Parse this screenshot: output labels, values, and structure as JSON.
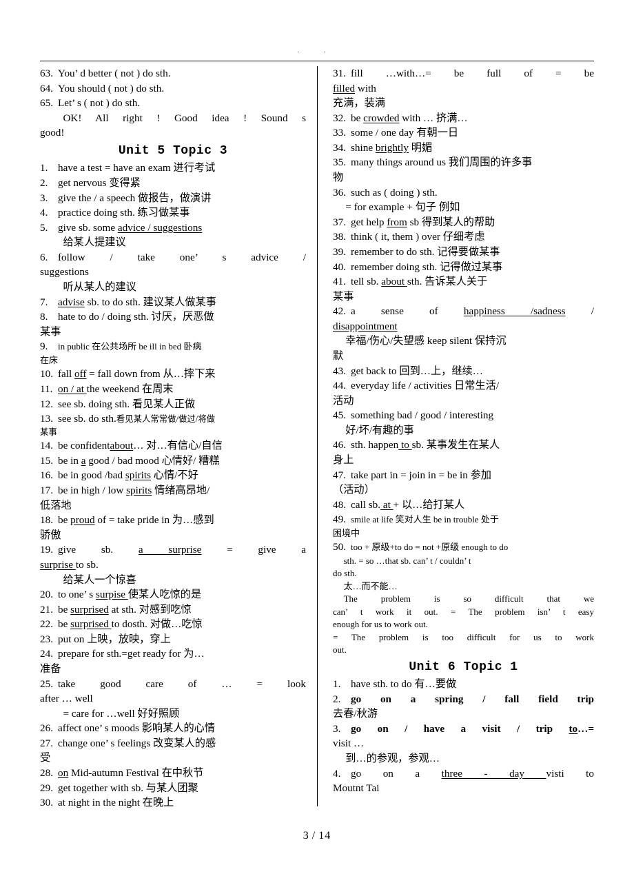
{
  "document": {
    "header_marks": "· ·",
    "footer": {
      "page": "3",
      "separator": "/",
      "total": "14"
    }
  },
  "left_column": {
    "entries": [
      {
        "num": "63.",
        "text": "You’ d better ( not ) do sth."
      },
      {
        "num": "64.",
        "text": "You should ( not ) do sth."
      },
      {
        "num": "65.",
        "text": "Let’ s ( not ) do sth."
      },
      {
        "num": "",
        "text": "OK! All right ! Good idea ! Sound s"
      },
      {
        "num": "",
        "text": "good!"
      }
    ],
    "unit_heading": "Unit 5 Topic 3",
    "items": [
      {
        "num": "1.",
        "line1": "have a test = have an exam 进行考试"
      },
      {
        "num": "2.",
        "line1": "get nervous  变得紧"
      },
      {
        "num": "3.",
        "line1": "give the / a speech 做报告，做演讲"
      },
      {
        "num": "4.",
        "line1": "practice doing sth. 练习做某事"
      },
      {
        "num": "5.",
        "line1_pre": "give sb. some ",
        "line1_u": "advice / suggestions",
        "line2": "给某人提建议"
      },
      {
        "num": "6.",
        "line1": "follow / take one’ s advice /",
        "line2": "suggestions",
        "line3": "听从某人的建议"
      },
      {
        "num": "7.",
        "line1_u": "advise",
        "line1_post": " sb. to do sth. 建议某人做某事"
      },
      {
        "num": "8.",
        "line1": "hate to do / doing sth. 讨厌，厌恶做",
        "line2": "某事"
      },
      {
        "num": "9.",
        "line1": "in public 在公共场所 be ill in bed  卧病",
        "line2": "在床",
        "small": true
      },
      {
        "num": "10.",
        "line1_pre": "fall ",
        "line1_u": "off",
        "line1_post": " = fall down from 从…摔下来"
      },
      {
        "num": "11.",
        "line1_u": "on / at ",
        "line1_post": "the weekend  在周末"
      },
      {
        "num": "12.",
        "line1": "see sb. doing sth. 看见某人正做"
      },
      {
        "num": "13.",
        "line1": "see sb. do sth.",
        "line1_small": "看见某人常常做/做过/将做",
        "line2_small": "某事"
      },
      {
        "num": "14.",
        "line1_pre": "be confident",
        "line1_u": "about",
        "line1_post": "… 对…有信心/自信"
      },
      {
        "num": "15.",
        "line1_pre": "be in ",
        "line1_u": "a",
        "line1_post": " good / bad mood 心情好/ 糟糕"
      },
      {
        "num": "16.",
        "line1_pre": "be in good /bad ",
        "line1_u": "spirits",
        "line1_post": "  心情/不好"
      },
      {
        "num": "17.",
        "line1_pre": "be in high / low ",
        "line1_u": "spirits",
        "line1_post": " 情绪高昂地/",
        "line2": "低落地"
      },
      {
        "num": "18.",
        "line1_pre": "be ",
        "line1_u": "proud",
        "line1_post": " of = take pride in 为…感到",
        "line2": "骄傲"
      },
      {
        "num": "19.",
        "line1_pre": "give sb. ",
        "line1_u": "a  surprise",
        "line1_post": " = give a",
        "line2_u": "surprise ",
        "line2_post": "to sb.",
        "line3": "给某人一个惊喜"
      },
      {
        "num": "20.",
        "line1_pre": "to one’ s ",
        "line1_u": "surpise ",
        "line1_post": "使某人吃惊的是"
      },
      {
        "num": "21.",
        "line1_pre": "be ",
        "line1_u": "surprised",
        "line1_post": " at sth. 对感到吃惊"
      },
      {
        "num": "22.",
        "line1_pre": "be ",
        "line1_u": "surprised ",
        "line1_post": "to dosth. 对做…吃惊"
      },
      {
        "num": "23.",
        "line1": "put on 上映，放映，穿上"
      },
      {
        "num": "24.",
        "line1": "prepare for sth.=get ready for  为…",
        "line2": "准备"
      },
      {
        "num": "25.",
        "line1": "take good care of …  = look",
        "line2": "after … well",
        "line3": "= care for …well    好好照顾"
      },
      {
        "num": "26.",
        "line1": "affect one’ s moods 影响某人的心情"
      },
      {
        "num": "27.",
        "line1": "change one’ s feelings  改变某人的感",
        "line2": "受"
      },
      {
        "num": "28.",
        "line1_u": "on",
        "line1_post": " Mid-autumn Festival  在中秋节"
      },
      {
        "num": "29.",
        "line1": "get together with sb.    与某人团聚"
      },
      {
        "num": "30.",
        "line1": "at night   in the night   在晚上"
      }
    ]
  },
  "right_column": {
    "items": [
      {
        "num": "31.",
        "line1": "fill  …with…=  be  full  of  =  be",
        "line2_u": "filled",
        "line2_post": " with",
        "line3": "充满，装满"
      },
      {
        "num": "32.",
        "line1_pre": "be ",
        "line1_u": "crowded",
        "line1_post": " with …   挤满…"
      },
      {
        "num": "33.",
        "line1": "some / one day   有朝一日"
      },
      {
        "num": "34.",
        "line1_pre": "shine ",
        "line1_u": "brightly",
        "line1_post": "    明媚"
      },
      {
        "num": "35.",
        "line1": "many things around us 我们周围的许多事",
        "line2": "物"
      },
      {
        "num": "36.",
        "line1": "such as ( doing ) sth.",
        "line2": "= for example +     句子   例如"
      },
      {
        "num": "37.",
        "line1_pre": "get help ",
        "line1_u": "from",
        "line1_post": " sb  得到某人的帮助"
      },
      {
        "num": "38.",
        "line1": "think ( it, them ) over     仔细考虑"
      },
      {
        "num": "39.",
        "line1": "remember to do sth. 记得要做某事"
      },
      {
        "num": "40.",
        "line1": "remember doing sth. 记得做过某事"
      },
      {
        "num": "41.",
        "line1_pre": "tell sb. ",
        "line1_u": "about ",
        "line1_post": "sth.    告诉某人关于",
        "line2": "某事"
      },
      {
        "num": "42.",
        "line1_pre": "a  sense  of  ",
        "line1_u": "happiness  /sadness",
        "line1_post": "  /",
        "line2_u": "disappointment",
        "line3": "幸福/伤心/失望感  keep silent 保持沉",
        "line4": "默"
      },
      {
        "num": "43.",
        "line1": "get back to      回到…上，继续…"
      },
      {
        "num": "44.",
        "line1": "everyday life / activities 日常生活/",
        "line2": "活动"
      },
      {
        "num": "45.",
        "line1": "something bad / good / interesting",
        "line2": "好/坏/有趣的事"
      },
      {
        "num": "46.",
        "line1_pre": "sth. happen",
        "line1_u": " to ",
        "line1_post": "sb.    某事发生在某人",
        "line2": "身上"
      },
      {
        "num": "47.",
        "line1": "take part in = join in = be in  参加",
        "line2": "（活动）"
      },
      {
        "num": "48.",
        "line1_pre": "call sb.",
        "line1_u": " at ",
        "line1_post": "+    以…给打某人"
      },
      {
        "num": "49.",
        "line1": "smile at life 笑对人生 be in trouble 处于",
        "line2": "困境中"
      },
      {
        "num": "50.",
        "line1": "too + 原级+to do   = not +原级 enough to do",
        "line2": "sth. = so …that sb. can’ t / couldn’ t",
        "line3": "do sth.",
        "line4": "太…而不能…"
      }
    ],
    "paragraph": {
      "l1": "The  problem  is  so  difficult  that  we",
      "l2": "can’ t work it out. = The problem isn’ t easy",
      "l3": "enough for us to work out.",
      "l4": "= The problem is too difficult for us to work",
      "l5": "out."
    },
    "unit_heading": "Unit 6 Topic 1",
    "unit6_items": [
      {
        "num": "1.",
        "line1": "have sth. to do  有…要做"
      },
      {
        "num": "2.",
        "line1": "go on a spring / fall field trip",
        "bold": true,
        "line2": "去春/秋游"
      },
      {
        "num": "3.",
        "line1_pre": "go on / have a visit / trip ",
        "line1_u": "to",
        "line1_post": "…=",
        "bold": true,
        "line2": "visit …",
        "line3": "到…的参观，参观…"
      },
      {
        "num": "4.",
        "line1_pre": "go  on  a  ",
        "line1_u": "three  -  day ",
        "line1_post": "visti  to",
        "line2": "Moutnt Tai"
      }
    ]
  }
}
